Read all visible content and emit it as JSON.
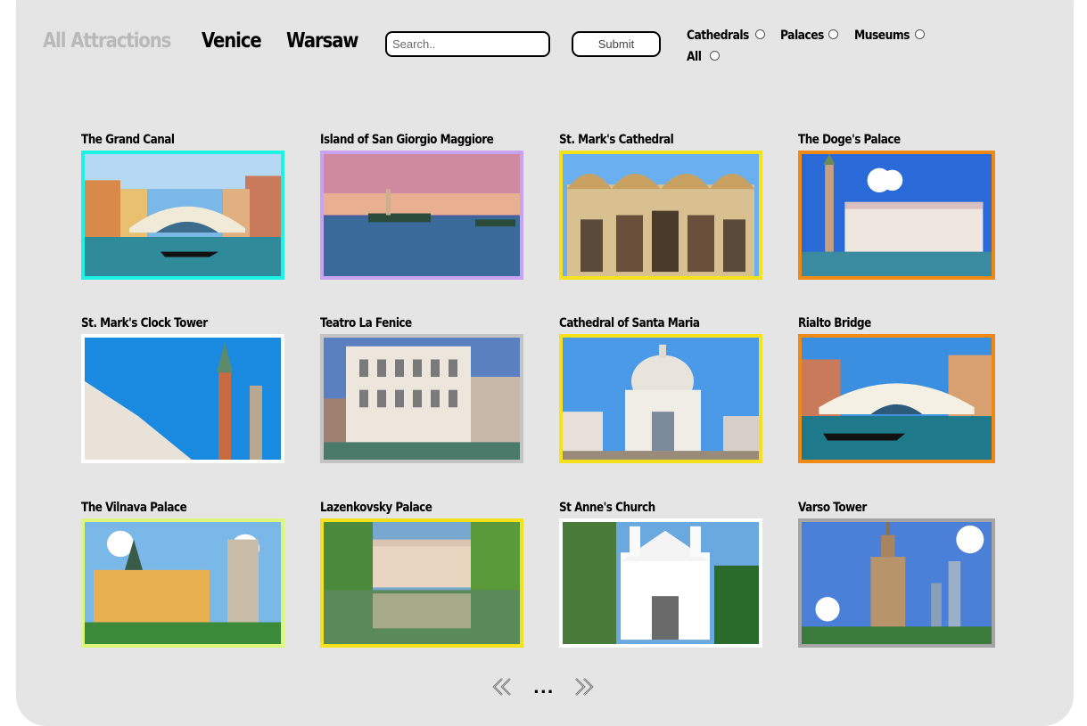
{
  "nav": {
    "all_attractions": "All Attractions",
    "venice": "Venice",
    "warsaw": "Warsaw"
  },
  "search": {
    "placeholder": "Search..",
    "value": ""
  },
  "submit_label": "Submit",
  "filters": [
    {
      "label": "Cathedrals",
      "checked": false
    },
    {
      "label": "Palaces",
      "checked": false
    },
    {
      "label": "Museums",
      "checked": false
    },
    {
      "label": "All",
      "checked": false
    }
  ],
  "cards": [
    {
      "title": "The Grand Canal",
      "border": "#1df3e5",
      "scene": "bridge"
    },
    {
      "title": "Island of San Giorgio Maggiore",
      "border": "#c9a2f0",
      "scene": "island"
    },
    {
      "title": "St. Mark's Cathedral",
      "border": "#f5e21d",
      "scene": "cathedral"
    },
    {
      "title": "The Doge's Palace",
      "border": "#f08a14",
      "scene": "palace"
    },
    {
      "title": "St. Mark's Clock Tower",
      "border": "#ffffff",
      "scene": "tower"
    },
    {
      "title": "Teatro La Fenice",
      "border": "#c4c4c4",
      "scene": "theatre"
    },
    {
      "title": "Cathedral of Santa Maria",
      "border": "#f5e21d",
      "scene": "dome"
    },
    {
      "title": "Rialto Bridge",
      "border": "#f08a14",
      "scene": "bridge2"
    },
    {
      "title": "The Vilnava Palace",
      "border": "#dcf77a",
      "scene": "villa"
    },
    {
      "title": "Lazenkovsky Palace",
      "border": "#f5e21d",
      "scene": "lake"
    },
    {
      "title": "St Anne's Church",
      "border": "#ffffff",
      "scene": "church"
    },
    {
      "title": "Varso Tower",
      "border": "#a5a5a5",
      "scene": "skyline"
    }
  ],
  "pagination": {
    "prev_icon": "double-chevron-left-icon",
    "ellipsis": "...",
    "next_icon": "double-chevron-right-icon"
  },
  "colors": {
    "panel": "#e5e5e5",
    "muted_nav": "#b9b9b9"
  }
}
